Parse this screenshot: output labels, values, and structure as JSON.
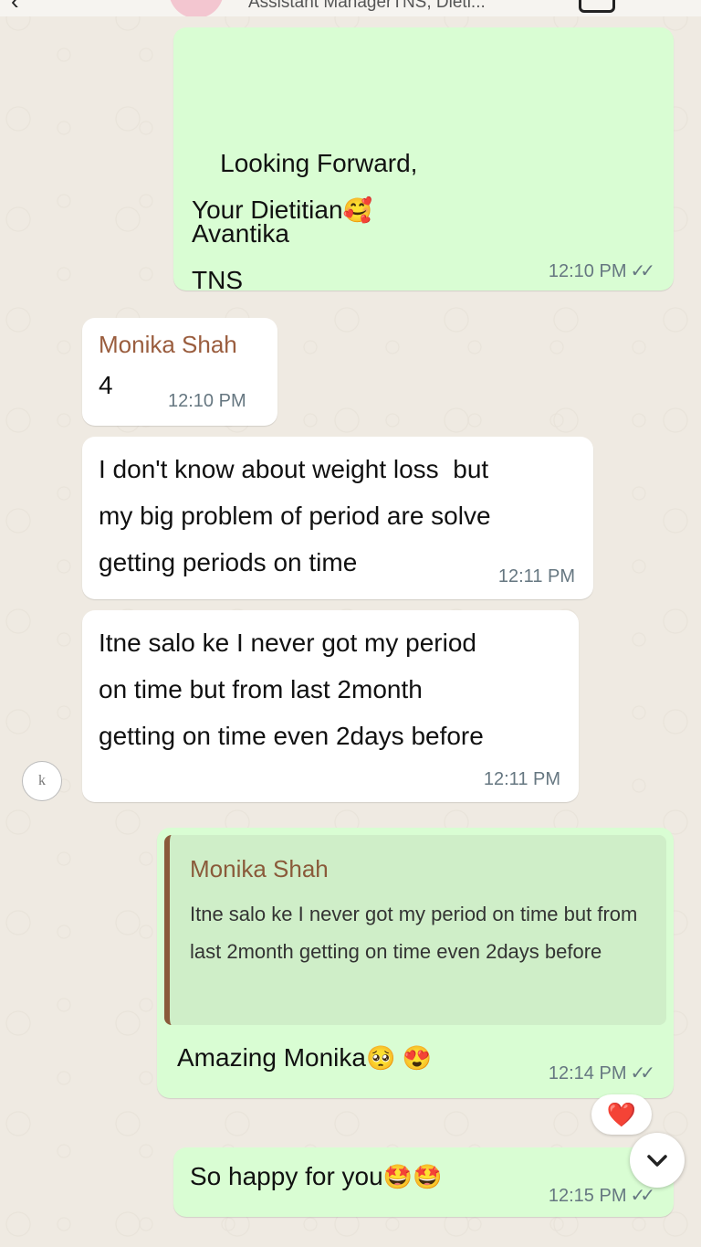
{
  "header": {
    "subtitle": "Assistant ManagerTNS, Dieti..."
  },
  "messages": {
    "m1": {
      "lines": "Looking Forward,\nYour Dietitian",
      "emoji": "🥰",
      "lines2": "Avantika\nTNS",
      "time": "12:10 PM"
    },
    "m2": {
      "sender": "Monika Shah",
      "text": "4",
      "time": "12:10 PM"
    },
    "m3": {
      "text": "I don't know about weight loss  but\nmy big problem of period are solve\ngetting periods on time",
      "time": "12:11 PM"
    },
    "m4": {
      "text": "Itne salo ke I never got my period\non time but from last 2month\ngetting on time even 2days before",
      "time": "12:11 PM"
    },
    "m5": {
      "quote_sender": "Monika Shah",
      "quote_text": "Itne salo ke I never got my period on time but from last 2month getting on time even 2days before",
      "text": "Amazing Monika",
      "emoji": "🥺 😍",
      "time": "12:14 PM"
    },
    "m6": {
      "reaction": "❤️",
      "text": "So happy for you",
      "emoji": "🤩🤩",
      "time": "12:15 PM"
    }
  },
  "avatar_initials": "k",
  "colors": {
    "outgoing": "#d9fdd3",
    "incoming": "#ffffff",
    "sender": "#9a5d3e",
    "background": "#efeae2"
  }
}
